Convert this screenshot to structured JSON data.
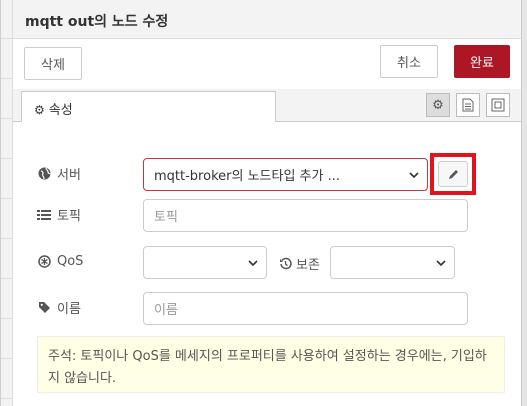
{
  "dialog": {
    "title": "mqtt out의 노드 수정"
  },
  "toolbar": {
    "delete_label": "삭제",
    "cancel_label": "취소",
    "done_label": "완료"
  },
  "tabs": {
    "properties_label": "속성"
  },
  "form": {
    "server": {
      "label": "서버",
      "value": "mqtt-broker의 노드타입 추가 ..."
    },
    "topic": {
      "label": "토픽",
      "placeholder": "토픽"
    },
    "qos": {
      "label": "QoS",
      "value": ""
    },
    "retain": {
      "label": "보존",
      "value": ""
    },
    "name": {
      "label": "이름",
      "placeholder": "이름"
    }
  },
  "note": {
    "text": "주석: 토픽이나 QoS를 메세지의 프로퍼티를 사용하여 설정하는 경우에는, 기입하지 않습니다."
  },
  "colors": {
    "accent": "#ad1625",
    "highlight": "#e3121c",
    "note_bg": "#ffffe5"
  },
  "icons": [
    "gear-icon",
    "document-icon",
    "frame-icon",
    "globe-icon",
    "topic-icon",
    "qos-icon",
    "history-icon",
    "tag-icon",
    "pencil-icon",
    "chevron-down-icon"
  ]
}
